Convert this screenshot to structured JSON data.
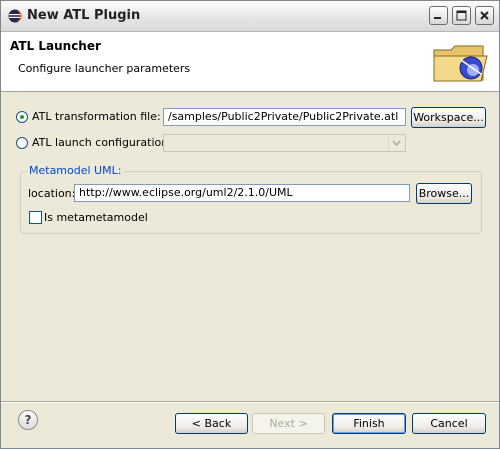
{
  "window": {
    "title": "New ATL Plugin"
  },
  "header": {
    "title": "ATL Launcher",
    "subtitle": "Configure launcher parameters"
  },
  "transformation": {
    "label": "ATL transformation file:",
    "value": "/samples/Public2Private/Public2Private.atl",
    "button": "Workspace...",
    "selected": true
  },
  "launch_config": {
    "label": "ATL launch configuration:",
    "value": "",
    "selected": false
  },
  "metamodel": {
    "group_title": "Metamodel UML:",
    "location_label": "location:",
    "location_value": "http://www.eclipse.org/uml2/2.1.0/UML",
    "browse_button": "Browse...",
    "checkbox_label": "Is metametamodel",
    "checked": false
  },
  "footer": {
    "back": "< Back",
    "next": "Next >",
    "finish": "Finish",
    "cancel": "Cancel"
  },
  "icons": [
    "eclipse-icon",
    "minimize-icon",
    "maximize-icon",
    "close-icon",
    "folder-wizard-icon",
    "help-icon"
  ]
}
